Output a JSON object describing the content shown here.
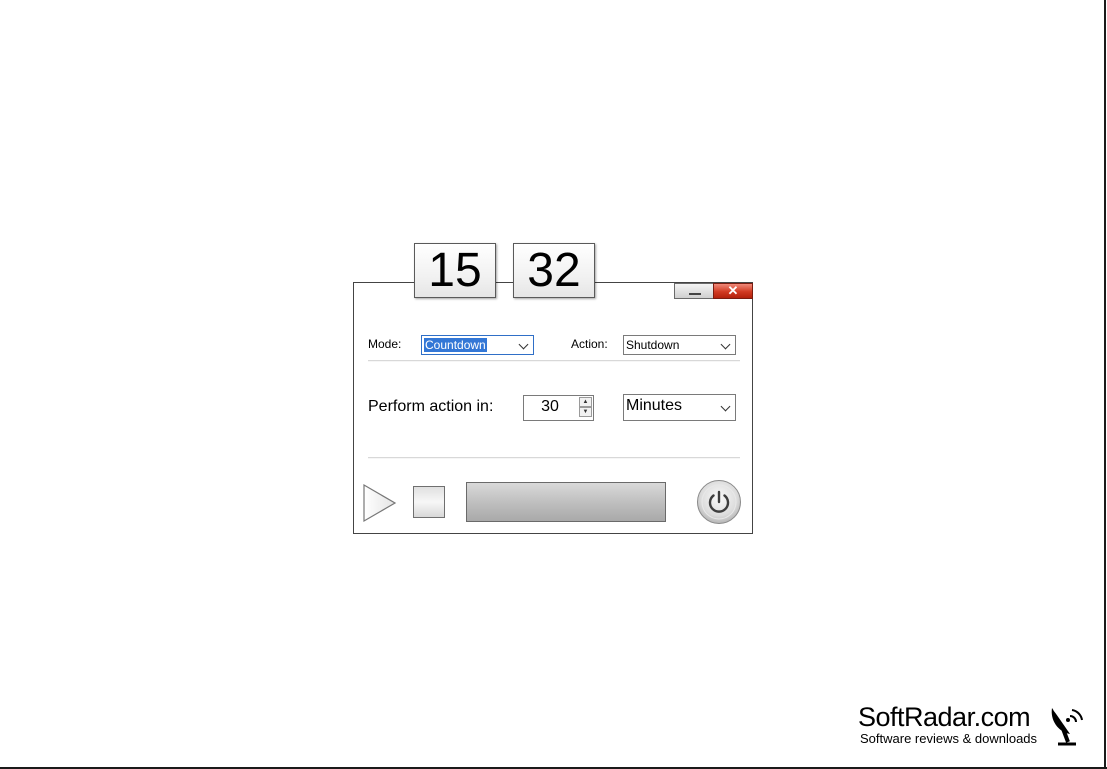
{
  "clock": {
    "hours": "15",
    "minutes": "32"
  },
  "window": {
    "minimize_icon": "minimize-icon",
    "close_icon": "close-icon",
    "close_glyph": "✕"
  },
  "mode": {
    "label": "Mode:",
    "value": "Countdown"
  },
  "action": {
    "label": "Action:",
    "value": "Shutdown"
  },
  "timer": {
    "label": "Perform action in:",
    "amount": "30",
    "unit": "Minutes"
  },
  "controls": {
    "play_icon": "play-icon",
    "stop_icon": "stop-icon",
    "power_icon": "power-icon",
    "progress": 0
  },
  "watermark": {
    "name": "SoftRadar.com",
    "tagline": "Software reviews & downloads"
  },
  "colors": {
    "close_red": "#d13a22",
    "selection_blue": "#3377d6"
  }
}
